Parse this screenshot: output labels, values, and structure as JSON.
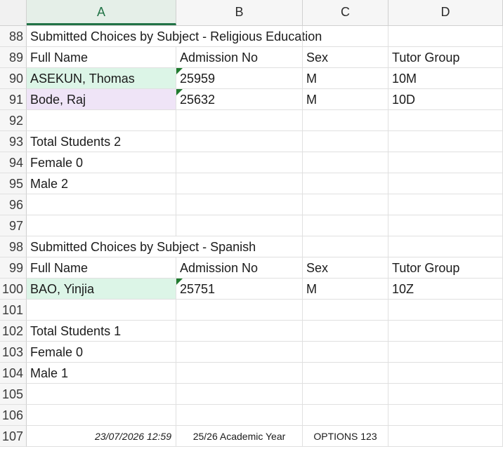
{
  "columns": [
    "A",
    "B",
    "C",
    "D"
  ],
  "selected_column": "A",
  "rows": [
    {
      "n": "88",
      "a": "Submitted Choices by Subject - Religious Education",
      "b": "",
      "c": "",
      "d": "",
      "fill": "",
      "flag": false
    },
    {
      "n": "89",
      "a": "Full Name",
      "b": "Admission No",
      "c": "Sex",
      "d": "Tutor Group",
      "fill": "",
      "flag": false
    },
    {
      "n": "90",
      "a": "ASEKUN, Thomas",
      "b": "25959",
      "c": "M",
      "d": "10M",
      "fill": "green",
      "flag": true
    },
    {
      "n": "91",
      "a": "Bode, Raj",
      "b": "25632",
      "c": "M",
      "d": "10D",
      "fill": "lilac",
      "flag": true
    },
    {
      "n": "92",
      "a": "",
      "b": "",
      "c": "",
      "d": "",
      "fill": "",
      "flag": false
    },
    {
      "n": "93",
      "a": "Total Students  2",
      "b": "",
      "c": "",
      "d": "",
      "fill": "",
      "flag": false
    },
    {
      "n": "94",
      "a": "Female  0",
      "b": "",
      "c": "",
      "d": "",
      "fill": "",
      "flag": false
    },
    {
      "n": "95",
      "a": "Male  2",
      "b": "",
      "c": "",
      "d": "",
      "fill": "",
      "flag": false
    },
    {
      "n": "96",
      "a": "",
      "b": "",
      "c": "",
      "d": "",
      "fill": "",
      "flag": false
    },
    {
      "n": "97",
      "a": "",
      "b": "",
      "c": "",
      "d": "",
      "fill": "",
      "flag": false
    },
    {
      "n": "98",
      "a": "Submitted Choices by Subject - Spanish",
      "b": "",
      "c": "",
      "d": "",
      "fill": "",
      "flag": false
    },
    {
      "n": "99",
      "a": "Full Name",
      "b": "Admission No",
      "c": "Sex",
      "d": "Tutor Group",
      "fill": "",
      "flag": false
    },
    {
      "n": "100",
      "a": "BAO, Yinjia",
      "b": "25751",
      "c": "M",
      "d": "10Z",
      "fill": "green",
      "flag": true
    },
    {
      "n": "101",
      "a": "",
      "b": "",
      "c": "",
      "d": "",
      "fill": "",
      "flag": false
    },
    {
      "n": "102",
      "a": "Total Students  1",
      "b": "",
      "c": "",
      "d": "",
      "fill": "",
      "flag": false
    },
    {
      "n": "103",
      "a": "Female  0",
      "b": "",
      "c": "",
      "d": "",
      "fill": "",
      "flag": false
    },
    {
      "n": "104",
      "a": "Male  1",
      "b": "",
      "c": "",
      "d": "",
      "fill": "",
      "flag": false
    },
    {
      "n": "105",
      "a": "",
      "b": "",
      "c": "",
      "d": "",
      "fill": "",
      "flag": false
    },
    {
      "n": "106",
      "a": "",
      "b": "",
      "c": "",
      "d": "",
      "fill": "",
      "flag": false
    }
  ],
  "footer": {
    "n": "107",
    "date": "23/07/2026 12:59",
    "year": "25/26 Academic Year",
    "options": "OPTIONS 123"
  }
}
